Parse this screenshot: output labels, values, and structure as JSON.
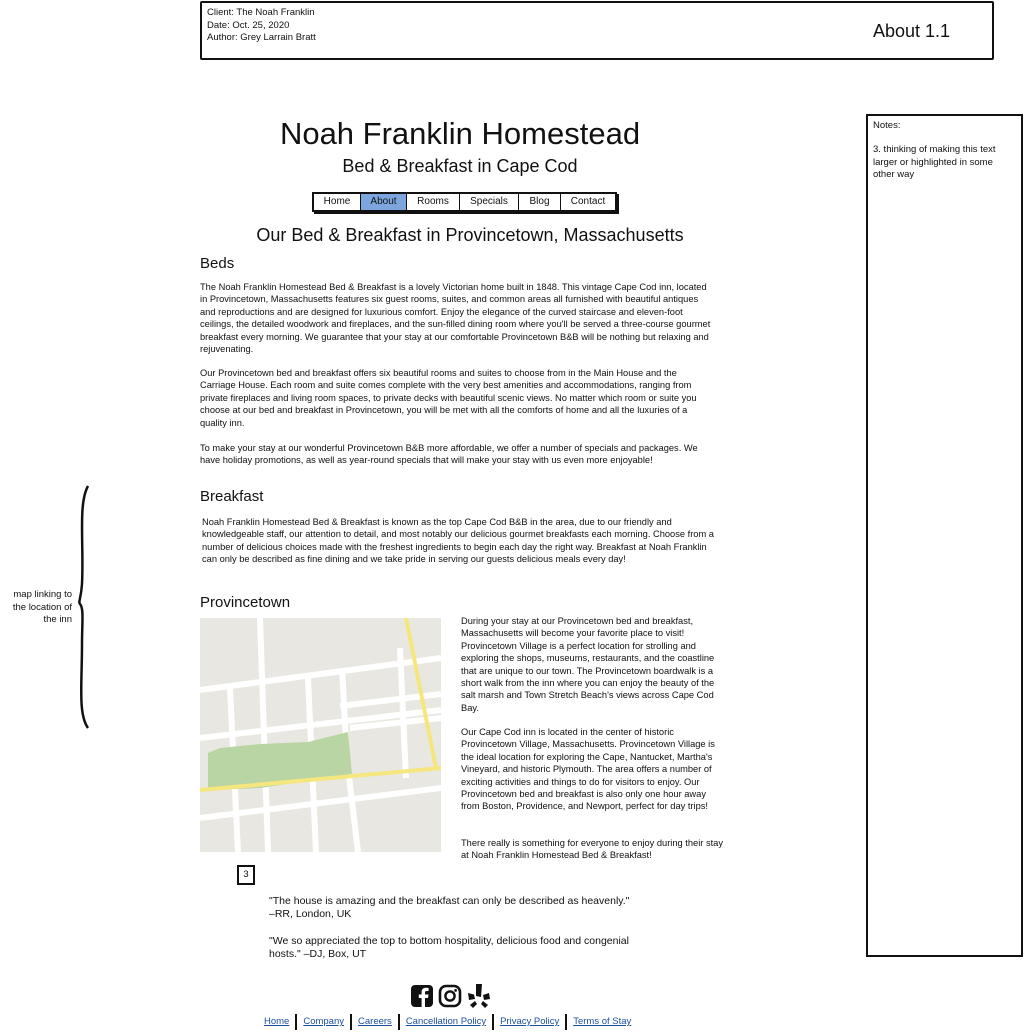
{
  "header": {
    "client": "Client: The Noah Franklin",
    "date": "Date: Oct. 25, 2020",
    "author": "Author: Grey Larrain Bratt",
    "page_name": "About 1.1"
  },
  "notes": {
    "label": "Notes:",
    "text": "3. thinking of making this text larger or highlighted in some other way"
  },
  "site": {
    "title": "Noah Franklin Homestead",
    "subtitle": "Bed & Breakfast in Cape Cod"
  },
  "nav": {
    "items": [
      {
        "label": "Home"
      },
      {
        "label": "About"
      },
      {
        "label": "Rooms"
      },
      {
        "label": "Specials"
      },
      {
        "label": "Blog"
      },
      {
        "label": "Contact"
      }
    ],
    "active": "About"
  },
  "main": {
    "heading": "Our Bed & Breakfast in Provincetown, Massachusetts",
    "beds": {
      "title": "Beds",
      "p1": "The Noah Franklin Homestead Bed & Breakfast is a lovely Victorian home built in 1848. This vintage Cape Cod inn, located in Provincetown, Massachusetts features six guest rooms, suites, and common areas all furnished with beautiful antiques and reproductions and are designed for luxurious comfort. Enjoy the elegance of the curved staircase and eleven-foot ceilings, the detailed woodwork and fireplaces, and the sun-filled dining room where you'll be served a three-course gourmet breakfast every morning. We guarantee that your stay at our comfortable Provincetown B&B will be nothing but relaxing and rejuvenating.",
      "p2": "Our Provincetown bed and breakfast offers six beautiful rooms and suites to choose from in the Main House and the Carriage House. Each room and suite comes complete with the very best amenities and accommodations, ranging from private fireplaces and living room spaces, to private decks with beautiful scenic views. No matter which room or suite you choose at our bed and breakfast in Provincetown, you will be met with all the comforts of home and all the luxuries of a quality inn.",
      "p3": "To make your stay at our wonderful Provincetown B&B more affordable, we offer a number of specials and packages. We have holiday promotions, as well as year-round specials that will make your stay with us even more enjoyable!"
    },
    "breakfast": {
      "title": "Breakfast",
      "p1": "Noah Franklin Homestead Bed & Breakfast is known as the top Cape Cod B&B in the area, due to our friendly and knowledgeable staff, our attention to detail, and most notably our delicious gourmet breakfasts each morning. Choose from a number of delicious choices made with the freshest ingredients to begin each day the right way. Breakfast at Noah Franklin can only be described as fine dining and we take pride in serving our guests delicious meals every day!"
    },
    "provincetown": {
      "title": "Provincetown",
      "p1": "During your stay at our Provincetown bed and breakfast, Massachusetts will become your favorite place to visit! Provincetown Village is a perfect location for strolling and exploring the shops, museums, restaurants, and the coastline that are unique to our town. The Provincetown boardwalk is a short walk from the inn where you can enjoy the beauty of the salt marsh and Town Stretch Beach's views across Cape Cod Bay.",
      "p2": "Our Cape Cod inn is located in the center of historic Provincetown Village, Massachusetts. Provincetown Village is the ideal location for exploring the Cape, Nantucket, Martha's Vineyard, and historic Plymouth. The area offers a number of exciting activities and things to do for visitors to enjoy. Our Provincetown bed and breakfast is also only one hour away from Boston, Providence, and Newport, perfect for day trips!",
      "p3": "There really is something for everyone to enjoy during their stay at Noah Franklin Homestead Bed & Breakfast!"
    },
    "badge": "3",
    "quotes": [
      {
        "line1": "\"The house is amazing and the breakfast can only be described as heavenly.\"",
        "line2": "–RR, London, UK"
      },
      {
        "line1": "\"We so appreciated the top to bottom hospitality, delicious food and congenial",
        "line2": "hosts.\" –DJ, Box, UT"
      }
    ]
  },
  "annotation": {
    "text": "map linking to the location of the inn"
  },
  "colors": {
    "nav_active": "#7ea6de",
    "link": "#1a4f9c",
    "map_bg": "#e9e7e1",
    "map_park": "#b9d5a3",
    "map_road_yellow": "#f5e77d"
  },
  "social": {
    "icons": [
      "facebook-icon",
      "instagram-icon",
      "yelp-icon"
    ]
  },
  "footer": {
    "links": [
      "Home",
      "Company",
      "Careers",
      "Cancellation Policy",
      "Privacy Policy",
      "Terms of Stay"
    ]
  }
}
